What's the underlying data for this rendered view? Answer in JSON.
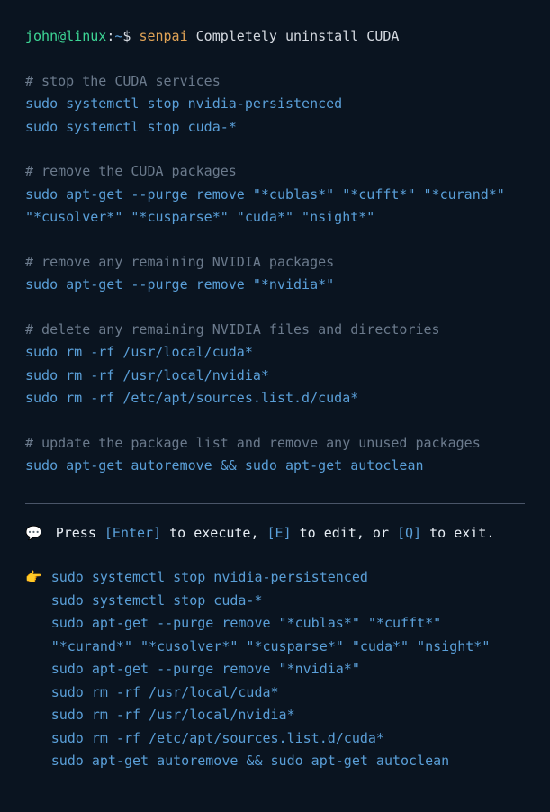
{
  "prompt": {
    "user": "john",
    "at": "@",
    "host": "linux",
    "colon": ":",
    "path": "~",
    "dollar": "$",
    "command": "senpai",
    "args": "Completely uninstall CUDA"
  },
  "sections": [
    {
      "comment": "# stop the CUDA services",
      "commands": [
        "sudo systemctl stop nvidia-persistenced",
        "sudo systemctl stop cuda-*"
      ]
    },
    {
      "comment": "# remove the CUDA packages",
      "commands": [
        "sudo apt-get --purge remove \"*cublas*\" \"*cufft*\" \"*curand*\" \"*cusolver*\" \"*cusparse*\" \"cuda*\" \"nsight*\""
      ]
    },
    {
      "comment": "# remove any remaining NVIDIA packages",
      "commands": [
        "sudo apt-get --purge remove \"*nvidia*\""
      ]
    },
    {
      "comment": "# delete any remaining NVIDIA files and directories",
      "commands": [
        "sudo rm -rf /usr/local/cuda*",
        "sudo rm -rf /usr/local/nvidia*",
        "sudo rm -rf /etc/apt/sources.list.d/cuda*"
      ]
    },
    {
      "comment": "# update the package list and remove any unused packages",
      "commands": [
        "sudo apt-get autoremove && sudo apt-get autoclean"
      ]
    }
  ],
  "instruction": {
    "icon": "💬",
    "press": " Press ",
    "enter": "[Enter]",
    "toExecute": " to execute, ",
    "edit": "[E]",
    "toEdit": " to edit, or ",
    "quit": "[Q]",
    "toExit": " to exit."
  },
  "exec": {
    "pointer": "👉",
    "lines": [
      "sudo systemctl stop nvidia-persistenced",
      "sudo systemctl stop cuda-*",
      "sudo apt-get --purge remove \"*cublas*\" \"*cufft*\" \"*curand*\" \"*cusolver*\" \"*cusparse*\" \"cuda*\" \"nsight*\"",
      "sudo apt-get --purge remove \"*nvidia*\"",
      "sudo rm -rf /usr/local/cuda*",
      "sudo rm -rf /usr/local/nvidia*",
      "sudo rm -rf /etc/apt/sources.list.d/cuda*",
      "sudo apt-get autoremove && sudo apt-get autoclean"
    ]
  }
}
